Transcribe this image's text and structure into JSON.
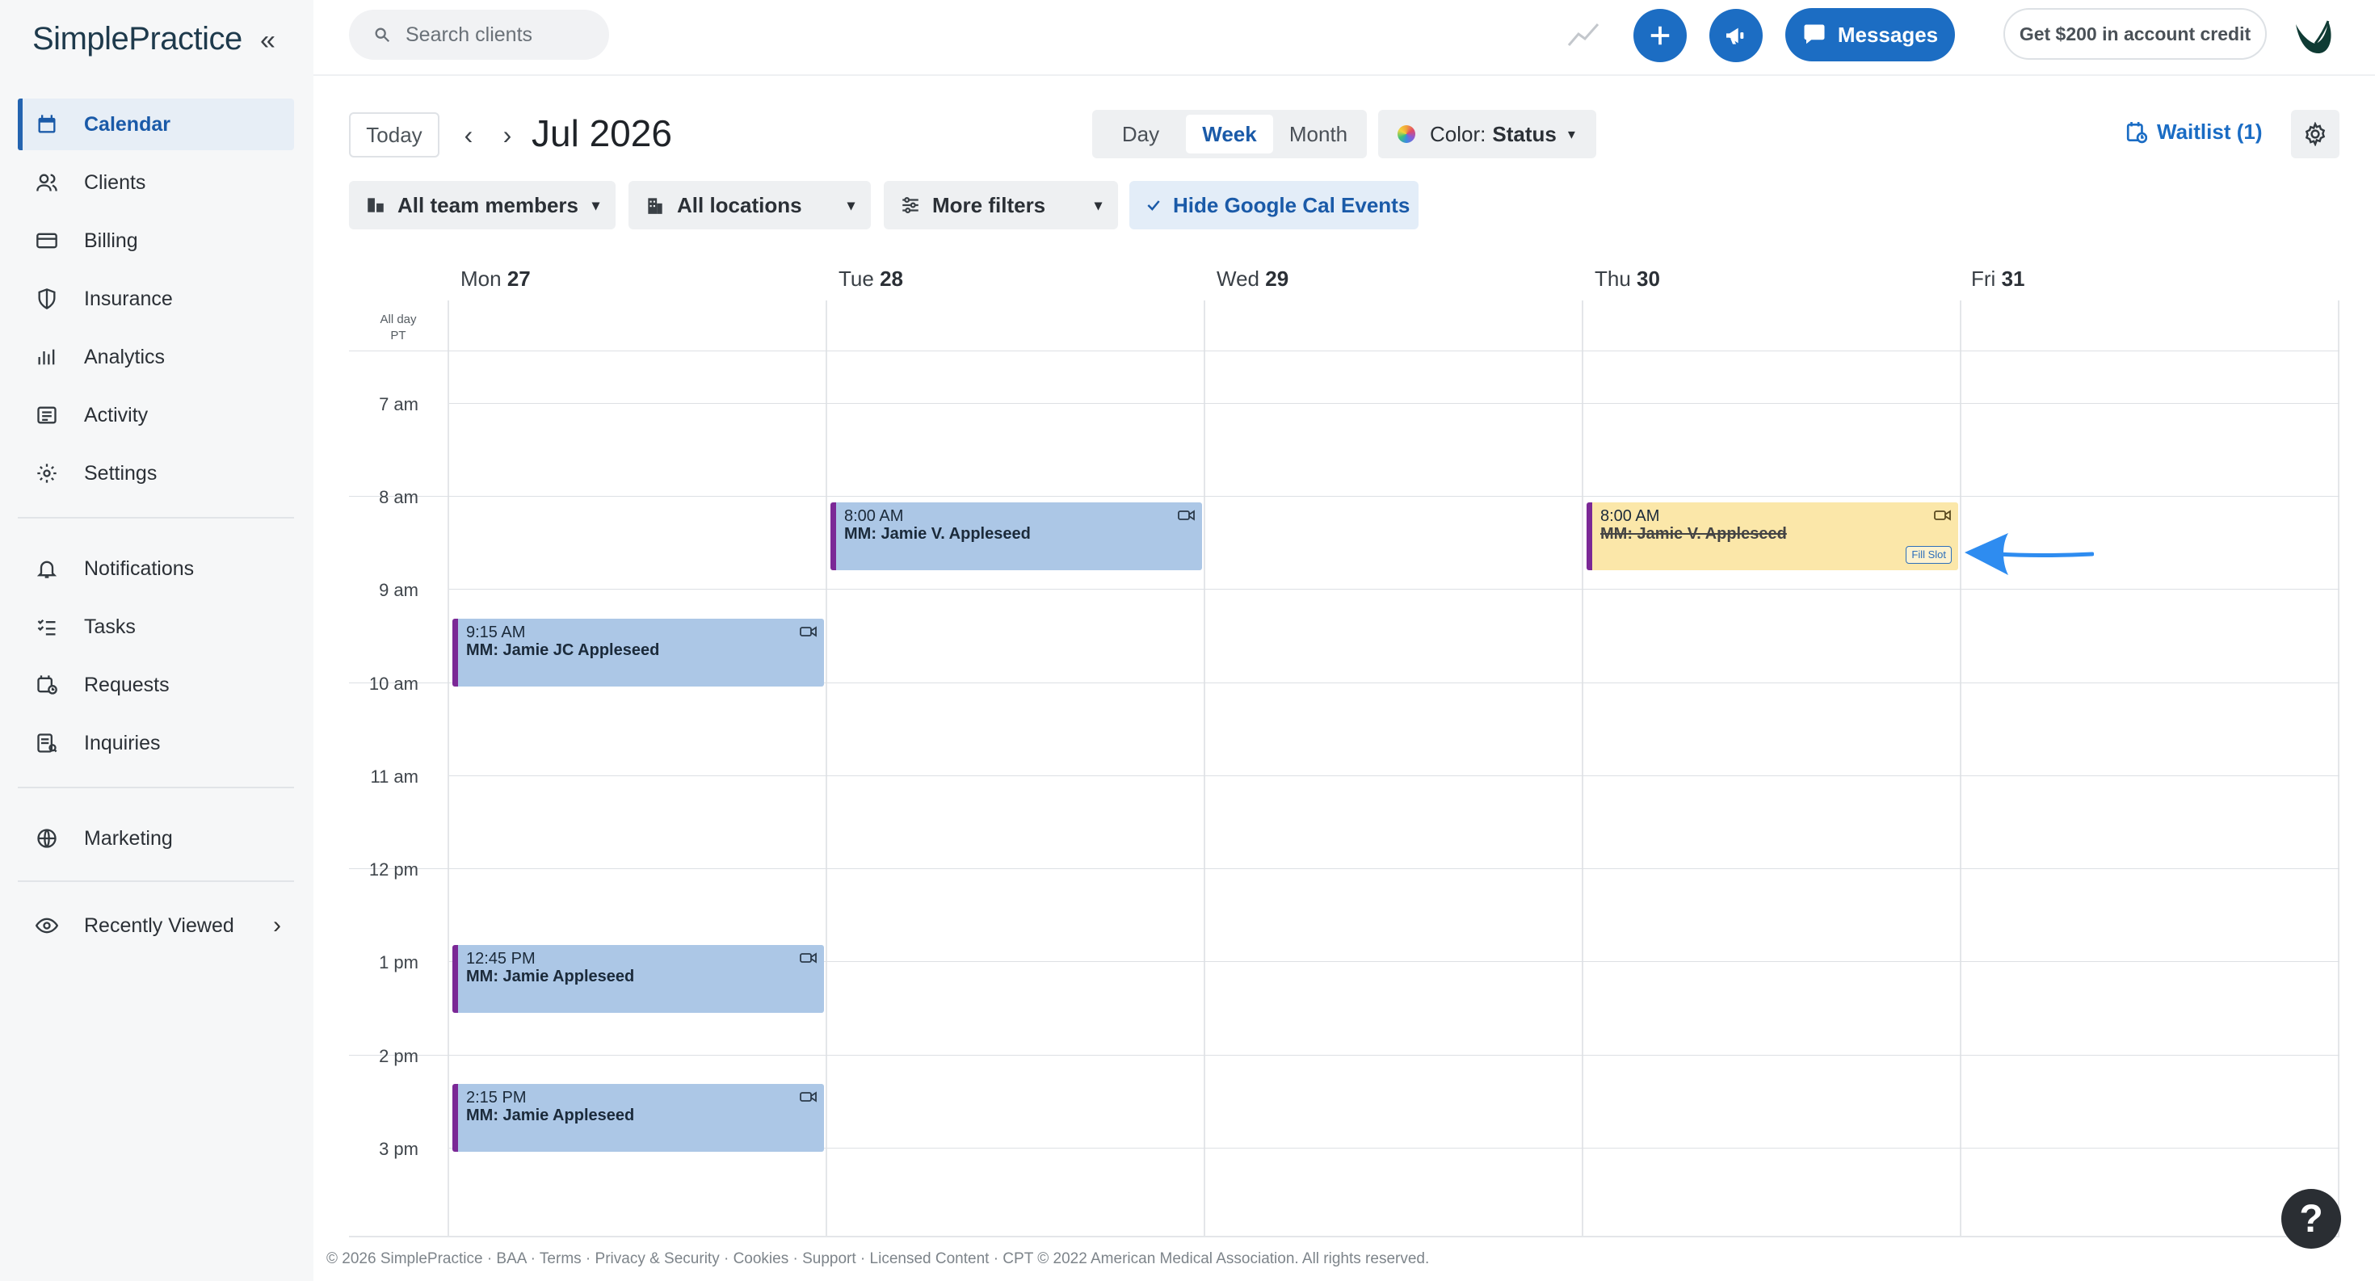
{
  "brand": {
    "logo_text": "SimplePractice"
  },
  "sidebar": {
    "items": [
      {
        "label": "Calendar",
        "icon": "calendar-icon",
        "active": true
      },
      {
        "label": "Clients",
        "icon": "clients-icon"
      },
      {
        "label": "Billing",
        "icon": "billing-icon"
      },
      {
        "label": "Insurance",
        "icon": "shield-icon"
      },
      {
        "label": "Analytics",
        "icon": "bar-chart-icon"
      },
      {
        "label": "Activity",
        "icon": "activity-icon"
      },
      {
        "label": "Settings",
        "icon": "gear-icon"
      },
      {
        "label": "Notifications",
        "icon": "bell-icon"
      },
      {
        "label": "Tasks",
        "icon": "tasks-icon"
      },
      {
        "label": "Requests",
        "icon": "requests-icon"
      },
      {
        "label": "Inquiries",
        "icon": "inquiries-icon"
      },
      {
        "label": "Marketing",
        "icon": "globe-icon"
      },
      {
        "label": "Recently Viewed",
        "icon": "eye-icon"
      }
    ]
  },
  "topbar": {
    "search_placeholder": "Search clients",
    "messages_label": "Messages",
    "credit_label": "Get $200 in account credit"
  },
  "toolbar": {
    "today_label": "Today",
    "month_label": "Jul 2026",
    "views": [
      "Day",
      "Week",
      "Month"
    ],
    "selected_view": "Week",
    "color_prefix": "Color:",
    "color_value": "Status",
    "waitlist_label": "Waitlist (1)",
    "filters": {
      "team": "All team members",
      "locations": "All locations",
      "more": "More filters",
      "google": "Hide Google Cal Events"
    }
  },
  "calendar": {
    "days": [
      {
        "name": "Mon",
        "num": "27"
      },
      {
        "name": "Tue",
        "num": "28"
      },
      {
        "name": "Wed",
        "num": "29"
      },
      {
        "name": "Thu",
        "num": "30"
      },
      {
        "name": "Fri",
        "num": "31"
      }
    ],
    "allday_label": "All day",
    "timezone_label": "PT",
    "hours": [
      "7 am",
      "8 am",
      "9 am",
      "10 am",
      "11 am",
      "12 pm",
      "1 pm",
      "2 pm",
      "3 pm"
    ],
    "appointments": [
      {
        "time": "9:15 AM",
        "client": "MM: Jamie JC Appleseed",
        "day": "Mon"
      },
      {
        "time": "12:45 PM",
        "client": "MM: Jamie Appleseed",
        "day": "Mon"
      },
      {
        "time": "2:15 PM",
        "client": "MM: Jamie Appleseed",
        "day": "Mon"
      },
      {
        "time": "8:00 AM",
        "client": "MM: Jamie V. Appleseed",
        "day": "Tue"
      },
      {
        "time": "8:00 AM",
        "client": "MM: Jamie V. Appleseed",
        "day": "Thu",
        "status": "cancelled",
        "badge": "Fill Slot"
      }
    ]
  },
  "footer": {
    "text": "© 2026 SimplePractice · BAA · Terms · Privacy & Security · Cookies · Support · Licensed Content · CPT © 2022 American Medical Association. All rights reserved."
  },
  "help_label": "?",
  "colors": {
    "accent": "#1c6dc3",
    "appointment_blue": "#acc7e6",
    "appointment_yellow": "#fbe7a9",
    "appointment_border": "#7b2896",
    "sidebar_bg": "#f6f7f8"
  }
}
